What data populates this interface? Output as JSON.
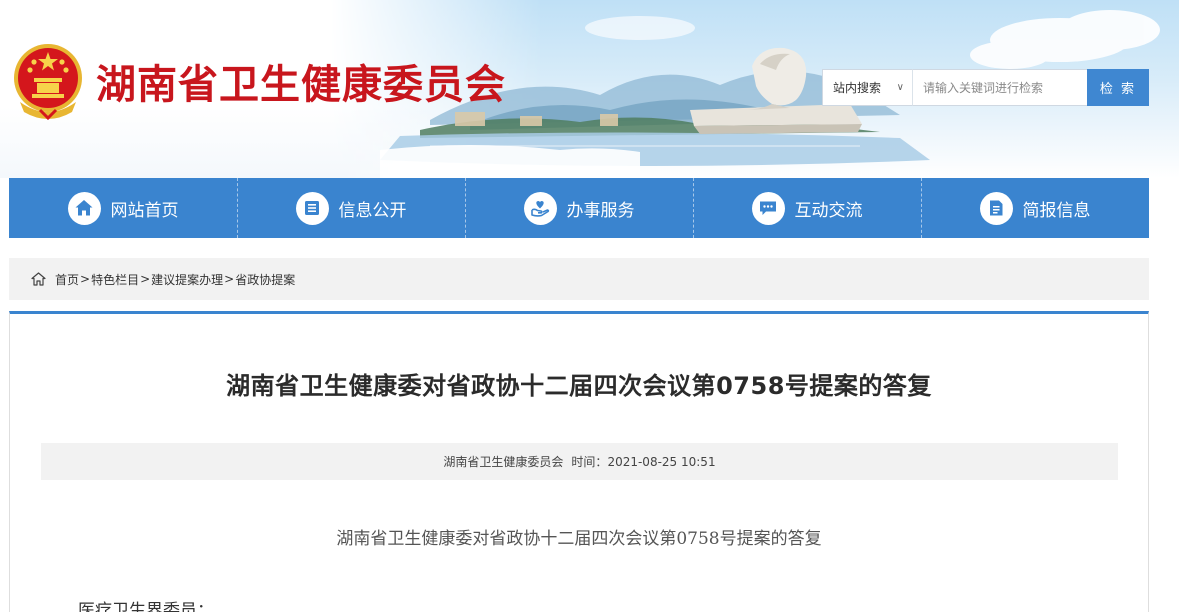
{
  "header": {
    "site_title": "湖南省卫生健康委员会",
    "emblem_icon": "national-emblem-icon"
  },
  "search": {
    "scope_label": "站内搜索",
    "placeholder": "请输入关键词进行检索",
    "button_label": "检 索"
  },
  "nav": {
    "items": [
      {
        "label": "网站首页",
        "icon": "home-icon"
      },
      {
        "label": "信息公开",
        "icon": "document-list-icon"
      },
      {
        "label": "办事服务",
        "icon": "heart-hand-icon"
      },
      {
        "label": "互动交流",
        "icon": "chat-bubble-icon"
      },
      {
        "label": "简报信息",
        "icon": "report-icon"
      }
    ]
  },
  "breadcrumb": {
    "items": [
      "首页",
      "特色栏目",
      "建议提案办理",
      "省政协提案"
    ],
    "separator": ">"
  },
  "article": {
    "title": "湖南省卫生健康委对省政协十二届四次会议第0758号提案的答复",
    "source": "湖南省卫生健康委员会",
    "time_label": "时间：",
    "time_value": "2021-08-25 10:51",
    "body_heading": "湖南省卫生健康委对省政协十二届四次会议第0758号提案的答复",
    "salutation": "医疗卫生界委员："
  },
  "colors": {
    "brand_red": "#c8161d",
    "nav_blue": "#3a84cf",
    "search_button_blue": "#3f87d1",
    "bar_gray": "#f2f2f2"
  }
}
